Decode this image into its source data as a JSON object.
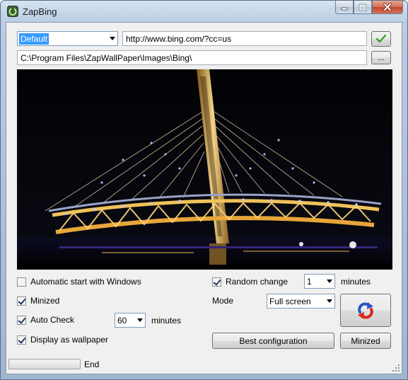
{
  "window": {
    "title": "ZapBing"
  },
  "top": {
    "profile_select": "Default",
    "url_value": "http://www.bing.com/?cc=us",
    "path_value": "C:\\Program Files\\ZapWallPaper\\Images\\Bing\\",
    "browse_label": "..."
  },
  "options": {
    "auto_start": {
      "label": "Automatic start with Windows",
      "checked": false
    },
    "minized": {
      "label": "Minized",
      "checked": true
    },
    "auto_check": {
      "label": "Auto Check",
      "checked": true,
      "interval": "60",
      "unit": "minutes"
    },
    "display_wallpaper": {
      "label": "Display as wallpaper",
      "checked": true
    },
    "random_change": {
      "label": "Random change",
      "checked": true,
      "interval": "1",
      "unit": "minutes"
    },
    "mode": {
      "label": "Mode",
      "value": "Full screen"
    }
  },
  "buttons": {
    "best_config": "Best configuration",
    "minized": "Minized"
  },
  "status": {
    "text": "End",
    "progress": 0
  },
  "colors": {
    "accent_blue": "#2a57c4",
    "accent_red": "#d8261b",
    "ok_green": "#3aa12a"
  },
  "icons": {
    "app": "zapbing-app-icon",
    "ok": "checkmark-icon",
    "refresh": "refresh-arrows-icon"
  }
}
